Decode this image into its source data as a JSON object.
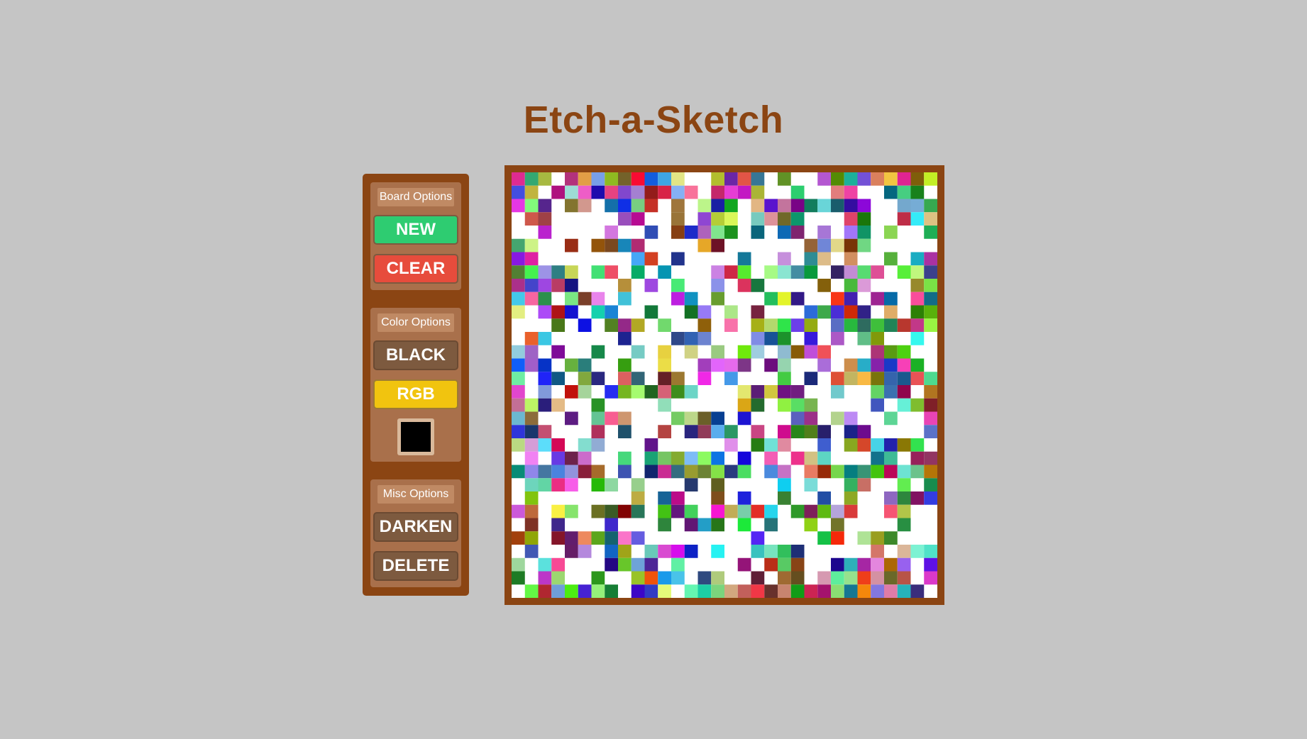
{
  "app": {
    "title": "Etch-a-Sketch"
  },
  "sidebar": {
    "board_options": {
      "label": "Board Options",
      "new_label": "NEW",
      "clear_label": "CLEAR"
    },
    "color_options": {
      "label": "Color Options",
      "black_label": "BLACK",
      "rgb_label": "RGB",
      "picker_value": "#000000"
    },
    "misc_options": {
      "label": "Misc Options",
      "darken_label": "DARKEN",
      "delete_label": "DELETE"
    }
  },
  "colors": {
    "title": "#8b4513",
    "frame": "#8b4513",
    "background": "#c5c5c5",
    "new": "#2ecc71",
    "clear": "#e74c3c",
    "rgb": "#f1c40f",
    "neutral_button": "#7d5a3f"
  },
  "board": {
    "grid_size": 32,
    "fill_ratio": 0.55,
    "seed": 20240611
  }
}
